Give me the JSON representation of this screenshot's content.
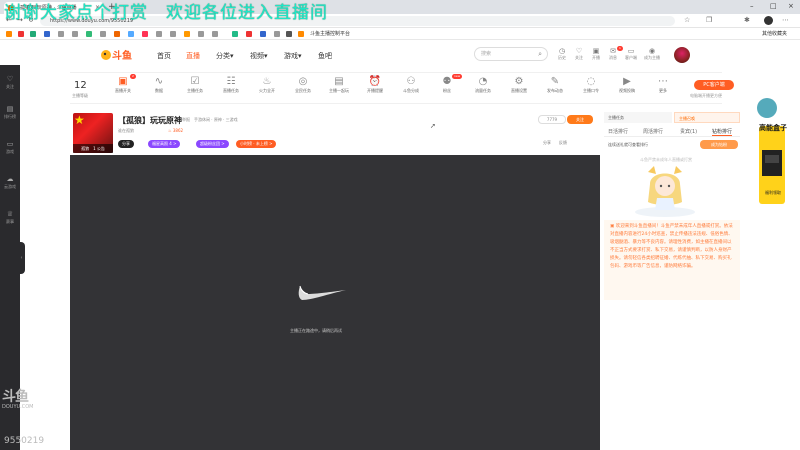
{
  "overlay": {
    "text": "谢谢大家点个打赏　欢迎各位进入直播间"
  },
  "browser": {
    "tab_title": "[孤狼]玩玩原神 · 斗鱼直播",
    "url": "https://www.douyu.com/9550219",
    "bookmark_label": "斗鱼主播控制平台",
    "bookmark_right": "其他收藏夹"
  },
  "header": {
    "nav": [
      {
        "label": "首页"
      },
      {
        "label": "直播"
      },
      {
        "label": "分类▾"
      },
      {
        "label": "视频▾"
      },
      {
        "label": "游戏▾"
      },
      {
        "label": "鱼吧"
      }
    ],
    "search_placeholder": "搜索",
    "icons": [
      {
        "label": "历史",
        "icon": "history-icon"
      },
      {
        "label": "关注",
        "icon": "follow-icon"
      },
      {
        "label": "开播",
        "icon": "broadcast-icon"
      },
      {
        "label": "消息",
        "icon": "message-icon"
      },
      {
        "label": "客户端",
        "icon": "client-icon"
      },
      {
        "label": "成为主播",
        "icon": "streamer-icon"
      }
    ]
  },
  "sidebar": {
    "items": [
      {
        "label": "关注",
        "icon": "heart-icon"
      },
      {
        "label": "排行榜",
        "icon": "rank-icon"
      },
      {
        "label": "游戏",
        "icon": "game-icon"
      },
      {
        "label": "云游戏",
        "icon": "cloud-icon"
      },
      {
        "label": "赛事",
        "icon": "trophy-icon"
      }
    ]
  },
  "subbar": {
    "level": "12",
    "level_label": "主播等级",
    "items": [
      {
        "label": "直播开关"
      },
      {
        "label": "数据"
      },
      {
        "label": "主播任务"
      },
      {
        "label": "直播任务"
      },
      {
        "label": "火力全开"
      },
      {
        "label": "全民任务"
      },
      {
        "label": "主播一起玩"
      },
      {
        "label": "开播提醒"
      },
      {
        "label": "斗鱼分成"
      },
      {
        "label": "粉丝"
      },
      {
        "label": "流量任务"
      },
      {
        "label": "直播设置"
      },
      {
        "label": "发布动态"
      },
      {
        "label": "主播口令"
      },
      {
        "label": "视频投稿"
      },
      {
        "label": "更多"
      }
    ],
    "pc_client": "PC客户端",
    "pc_client_sub": "电脑端开播更方便"
  },
  "room": {
    "title": "【孤狼】玩玩原神",
    "meta": "举报　手游休闲 · 原神 · 三游戏",
    "streamer": "谁在孤狼",
    "hot": "3862",
    "follow_count": "7779",
    "follow_label": "关注",
    "share": "分享　　反馈",
    "avatar_label": "孤狼　1 公告",
    "pills": [
      {
        "label": "分享",
        "color": "#222222"
      },
      {
        "label": "福星高照 4 >",
        "color": "#8b48ff"
      },
      {
        "label": "超级粉丝团 >",
        "color": "#8b48ff"
      },
      {
        "label": "小时榜 · 未上榜 >",
        "color": "#ff5d23"
      }
    ]
  },
  "player": {
    "message": "主播正在路途中，请稍后再试"
  },
  "right": {
    "top1": "主播任务",
    "top2": "主播召唤",
    "tabs": [
      "日活排行",
      "周活排行",
      "贵宾(1)",
      "钻粉排行"
    ],
    "rank_line": "连续送礼就可查看排行",
    "rank_btn": "成为钻粉",
    "rank_hint": "斗鱼严禁未成年人直播或打赏",
    "notice": "欢迎来到斗鱼直播间！斗鱼严禁未成年人直播或打赏。依法对直播内容进行24小时巡查，禁止传播违法违规、低俗色情、吸烟酗酒、暴力等不良内容。请理性消费，如主播在直播间以不正当方式要求打赏、私下交易，请谨慎判断，以防人身财产损失。请勿轻信各类招聘征婚、代练代抽、私下交易、购买礼包码、游戏币等广告信息，谨防网络诈骗。"
  },
  "ad": {
    "title": "高能盒子",
    "sub": "福利领取"
  },
  "watermark": {
    "logo": "斗鱼",
    "sub": "DOUYU.COM",
    "room": "9550219"
  }
}
